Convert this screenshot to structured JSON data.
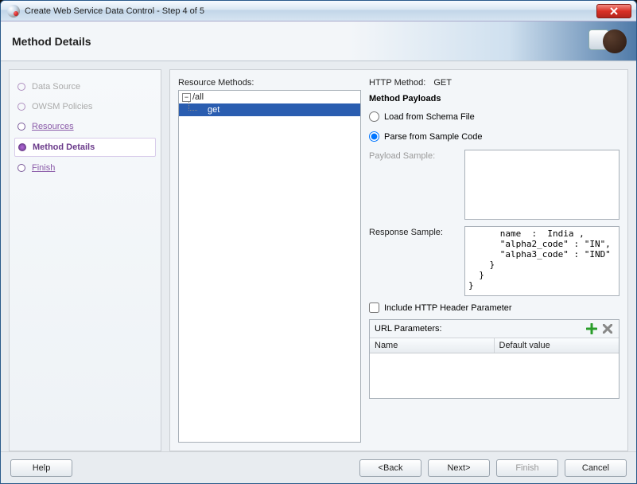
{
  "window": {
    "title": "Create Web Service Data Control - Step 4 of 5"
  },
  "header": {
    "title": "Method Details"
  },
  "steps": {
    "data_source": "Data Source",
    "owsm_policies": "OWSM Policies",
    "resources": "Resources",
    "method_details": "Method Details",
    "finish": "Finish"
  },
  "resource_methods": {
    "label": "Resource Methods:",
    "root": "/all",
    "child": "get"
  },
  "http": {
    "label": "HTTP Method:",
    "value": "GET"
  },
  "payloads": {
    "title": "Method Payloads",
    "opt_schema": "Load from Schema File",
    "opt_sample": "Parse from Sample Code",
    "payload_sample_label": "Payload Sample:",
    "response_sample_label": "Response Sample:",
    "response_sample_text": "      name  :  India ,\n      \"alpha2_code\" : \"IN\",\n      \"alpha3_code\" : \"IND\"\n    }\n  }\n}"
  },
  "include_http_header": "Include HTTP Header Parameter",
  "url_params": {
    "label": "URL Parameters:",
    "col_name": "Name",
    "col_default": "Default value"
  },
  "buttons": {
    "help": "Help",
    "back": "Back",
    "next": "Next",
    "finish": "Finish",
    "cancel": "Cancel"
  }
}
